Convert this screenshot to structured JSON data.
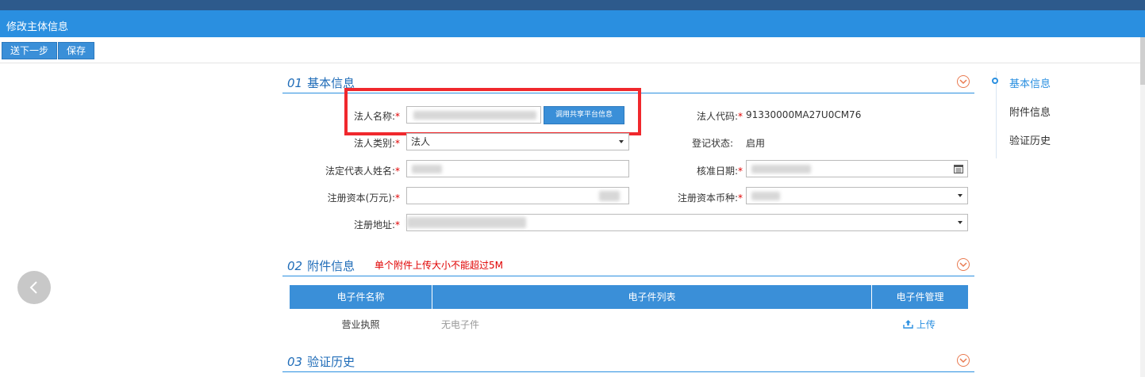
{
  "window": {
    "title": "修改主体信息"
  },
  "toolbar": {
    "next_label": "送下一步",
    "save_label": "保存"
  },
  "sections": {
    "basic": {
      "num": "01",
      "title": "基本信息"
    },
    "attach": {
      "num": "02",
      "title": "附件信息",
      "note": "单个附件上传大小不能超过5M"
    },
    "history": {
      "num": "03",
      "title": "验证历史"
    }
  },
  "form": {
    "legal_name_label": "法人名称:",
    "share_button": "调用共享平台信息",
    "legal_code_label": "法人代码:",
    "legal_code_value": "91330000MA27U0CM76",
    "legal_type_label": "法人类别:",
    "legal_type_value": "法人",
    "reg_status_label": "登记状态:",
    "reg_status_value": "启用",
    "rep_name_label": "法定代表人姓名:",
    "approve_date_label": "核准日期:",
    "reg_capital_label": "注册资本(万元):",
    "currency_label": "注册资本币种:",
    "address_label": "注册地址:",
    "required_mark": "*"
  },
  "attachments": {
    "headers": [
      "电子件名称",
      "电子件列表",
      "电子件管理"
    ],
    "rows": [
      {
        "name": "营业执照",
        "files": "无电子件",
        "action": "上传"
      }
    ]
  },
  "rail": {
    "items": [
      "基本信息",
      "附件信息",
      "验证历史"
    ],
    "active": 0
  },
  "colors": {
    "accent": "#2a8fe0",
    "required": "#e00000",
    "highlight": "#f0282d"
  }
}
